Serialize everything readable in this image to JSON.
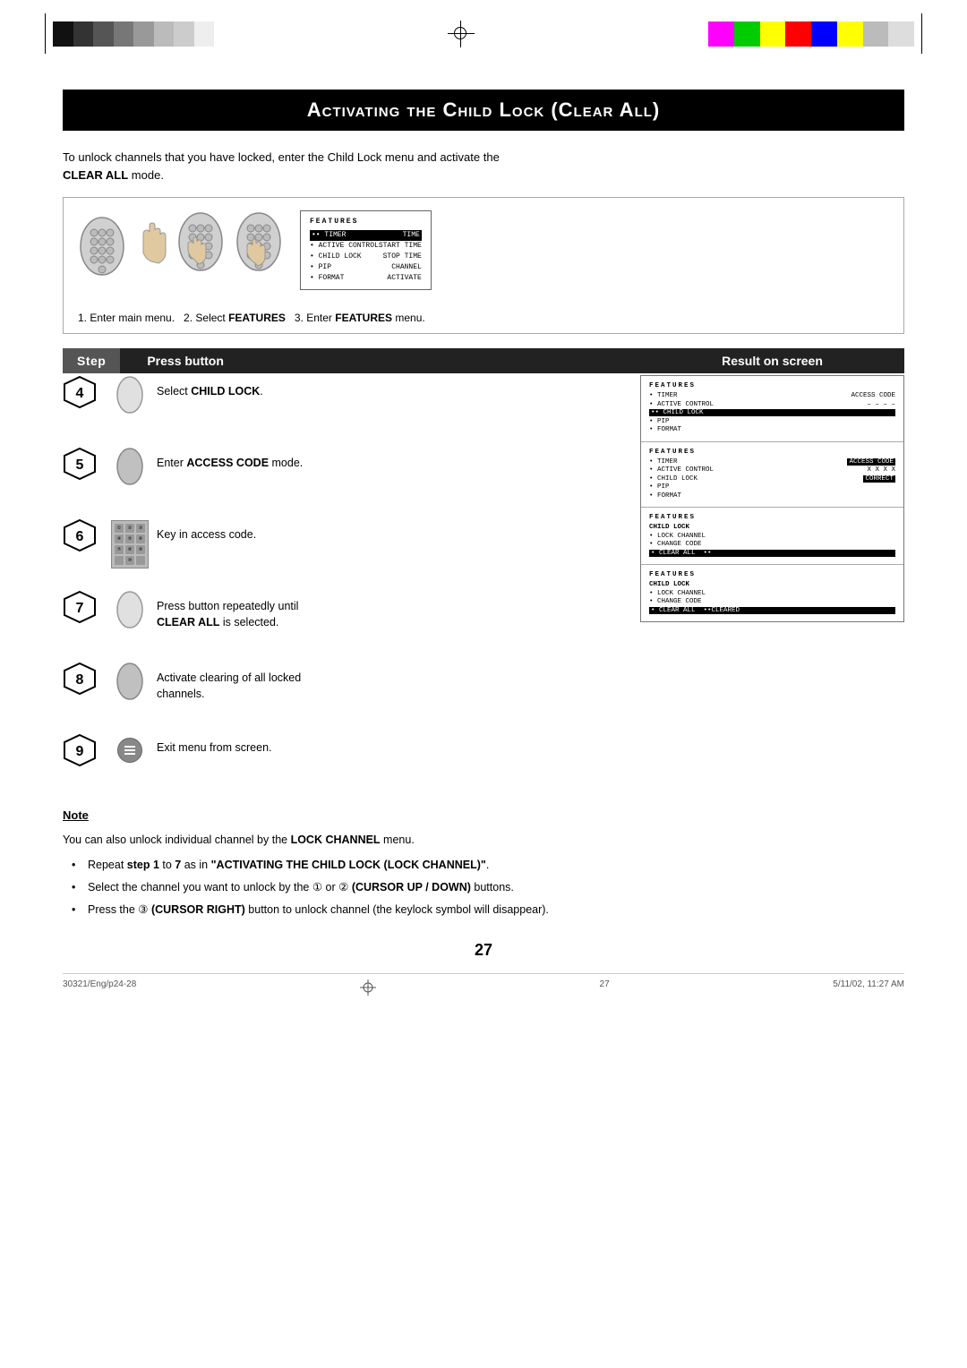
{
  "colors": {
    "grayscale": [
      "#1a1a1a",
      "#333",
      "#555",
      "#777",
      "#999",
      "#aaa",
      "#bbb",
      "#ccc"
    ],
    "colorbar": [
      "#ff00ff",
      "#00ff00",
      "#ffff00",
      "#ff0000",
      "#0000ff",
      "#ffff00",
      "#aaa",
      "#ccc"
    ],
    "colorbar_right": [
      "#ff00ff",
      "#00cc00",
      "#ffff00",
      "#ff0000",
      "#0000ff",
      "#ffff00",
      "#aaa",
      "#ccc"
    ]
  },
  "page": {
    "title": "Activating the Child Lock (Clear All)",
    "number": "27",
    "footer_left": "30321/Eng/p24-28",
    "footer_center": "27",
    "footer_right": "5/11/02, 11:27 AM"
  },
  "intro": {
    "text1": "To unlock channels that you have locked, enter the Child Lock menu and activate the",
    "text2_bold": "CLEAR ALL",
    "text3": " mode."
  },
  "steps_intro": {
    "text": "1. Enter main menu.  2. Select ",
    "features_bold": "FEATURES",
    "text2": "  3. Enter ",
    "features2_bold": "FEATURES",
    "text3": " menu."
  },
  "header_labels": {
    "step": "Step",
    "press": "Press button",
    "result": "Result on screen"
  },
  "steps": [
    {
      "num": "4",
      "desc": "Select ",
      "desc_bold": "CHILD LOCK",
      "desc_end": "."
    },
    {
      "num": "5",
      "desc": "Enter ",
      "desc_bold": "ACCESS CODE",
      "desc_end": " mode."
    },
    {
      "num": "6",
      "desc": "Key in access code."
    },
    {
      "num": "7",
      "desc": "Press button repeatedly until ",
      "desc_bold": "CLEAR ALL",
      "desc_end": " is selected."
    },
    {
      "num": "8",
      "desc": "Activate clearing of all locked channels."
    },
    {
      "num": "9",
      "desc": "Exit menu from screen."
    }
  ],
  "results": [
    {
      "title": "FEATURES",
      "items": [
        {
          "text": "• TIMER",
          "right": "ACCESS CODE"
        },
        {
          "text": "• ACTIVE CONTROL",
          "right": "– – – –"
        },
        {
          "text": "•• CHILD LOCK",
          "right": "",
          "highlighted": true
        },
        {
          "text": "• PIP",
          "right": ""
        },
        {
          "text": "• FORMAT",
          "right": ""
        }
      ]
    },
    {
      "title": "FEATURES",
      "items": [
        {
          "text": "• TIMER",
          "right": "ACCESS CODE",
          "right_hl": true
        },
        {
          "text": "• ACTIVE CONTROL",
          "right": "X X X X"
        },
        {
          "text": "• CHILD LOCK",
          "right": "CORRECT",
          "right_hl": true
        },
        {
          "text": "• PIP",
          "right": ""
        },
        {
          "text": "• FORMAT",
          "right": ""
        }
      ]
    },
    {
      "title": "FEATURES",
      "sub_items": [
        {
          "text": "CHILD LOCK"
        },
        {
          "text": "• LOCK CHANNEL"
        },
        {
          "text": "• CHANGE CODE"
        },
        {
          "text": "• CLEAR ALL  ••",
          "highlighted": true
        }
      ]
    },
    {
      "title": "FEATURES",
      "sub_items": [
        {
          "text": "CHILD LOCK"
        },
        {
          "text": "• LOCK CHANNEL"
        },
        {
          "text": "• CHANGE CODE"
        },
        {
          "text": "• CLEAR ALL  ••CLEARED",
          "highlighted": true
        }
      ]
    }
  ],
  "menu_preview": {
    "title": "FEATURES",
    "items": [
      {
        "left": "•• TIMER",
        "right": "TIME",
        "highlighted": true
      },
      {
        "left": "• ACTIVE CONTROL",
        "right": "START TIME"
      },
      {
        "left": "• CHILD LOCK",
        "right": "STOP TIME"
      },
      {
        "left": "• PIP",
        "right": "CHANNEL"
      },
      {
        "left": "• FORMAT",
        "right": "ACTIVATE"
      }
    ]
  },
  "note": {
    "title": "Note",
    "text1": "You can also unlock individual channel by the ",
    "lock_channel_bold": "LOCK CHANNEL",
    "text1_end": " menu.",
    "bullets": [
      "Repeat step 1 to 7 as in \"ACTIVATING THE CHILD LOCK (LOCK CHANNEL)\".",
      "Select the channel you want to unlock by the ① or ② (CURSOR UP / DOWN) buttons.",
      "Press the ③ (CURSOR RIGHT) button to unlock channel (the keylock symbol will disappear)."
    ]
  }
}
